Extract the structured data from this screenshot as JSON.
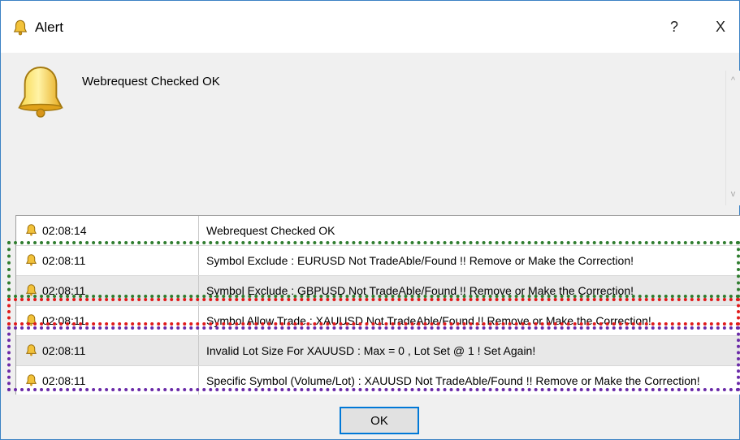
{
  "window": {
    "title": "Alert",
    "help_label": "?",
    "close_label": "X",
    "message": "Webrequest Checked OK"
  },
  "icons": {
    "title": "bell-icon",
    "message": "bell-icon",
    "row": "bell-icon",
    "scroll_up": "chevron-up-icon",
    "scroll_down": "chevron-down-icon"
  },
  "scroll": {
    "up": "^",
    "down": "v"
  },
  "log": {
    "rows": [
      {
        "time": "02:08:14",
        "message": "Webrequest Checked OK"
      },
      {
        "time": "02:08:11",
        "message": "Symbol Exclude :  EURUSD  Not TradeAble/Found !!  Remove or Make the Correction!"
      },
      {
        "time": "02:08:11",
        "message": "Symbol Exclude :  GBPUSD  Not TradeAble/Found !!  Remove or Make the Correction!"
      },
      {
        "time": "02:08:11",
        "message": "Symbol Allow Trade :  XAUUSD  Not TradeAble/Found !!  Remove or Make the Correction!"
      },
      {
        "time": "02:08:11",
        "message": "Invalid Lot Size For XAUUSD : Max = 0 , Lot Set @ 1 ! Set Again!"
      },
      {
        "time": "02:08:11",
        "message": "Specific Symbol (Volume/Lot) :  XAUUSD  Not TradeAble/Found !!  Remove or Make the Correction!"
      }
    ]
  },
  "highlight_colors": {
    "green": "#2f7d2f",
    "red": "#e01b1b",
    "purple": "#6a2aa8"
  },
  "buttons": {
    "ok": "OK"
  }
}
